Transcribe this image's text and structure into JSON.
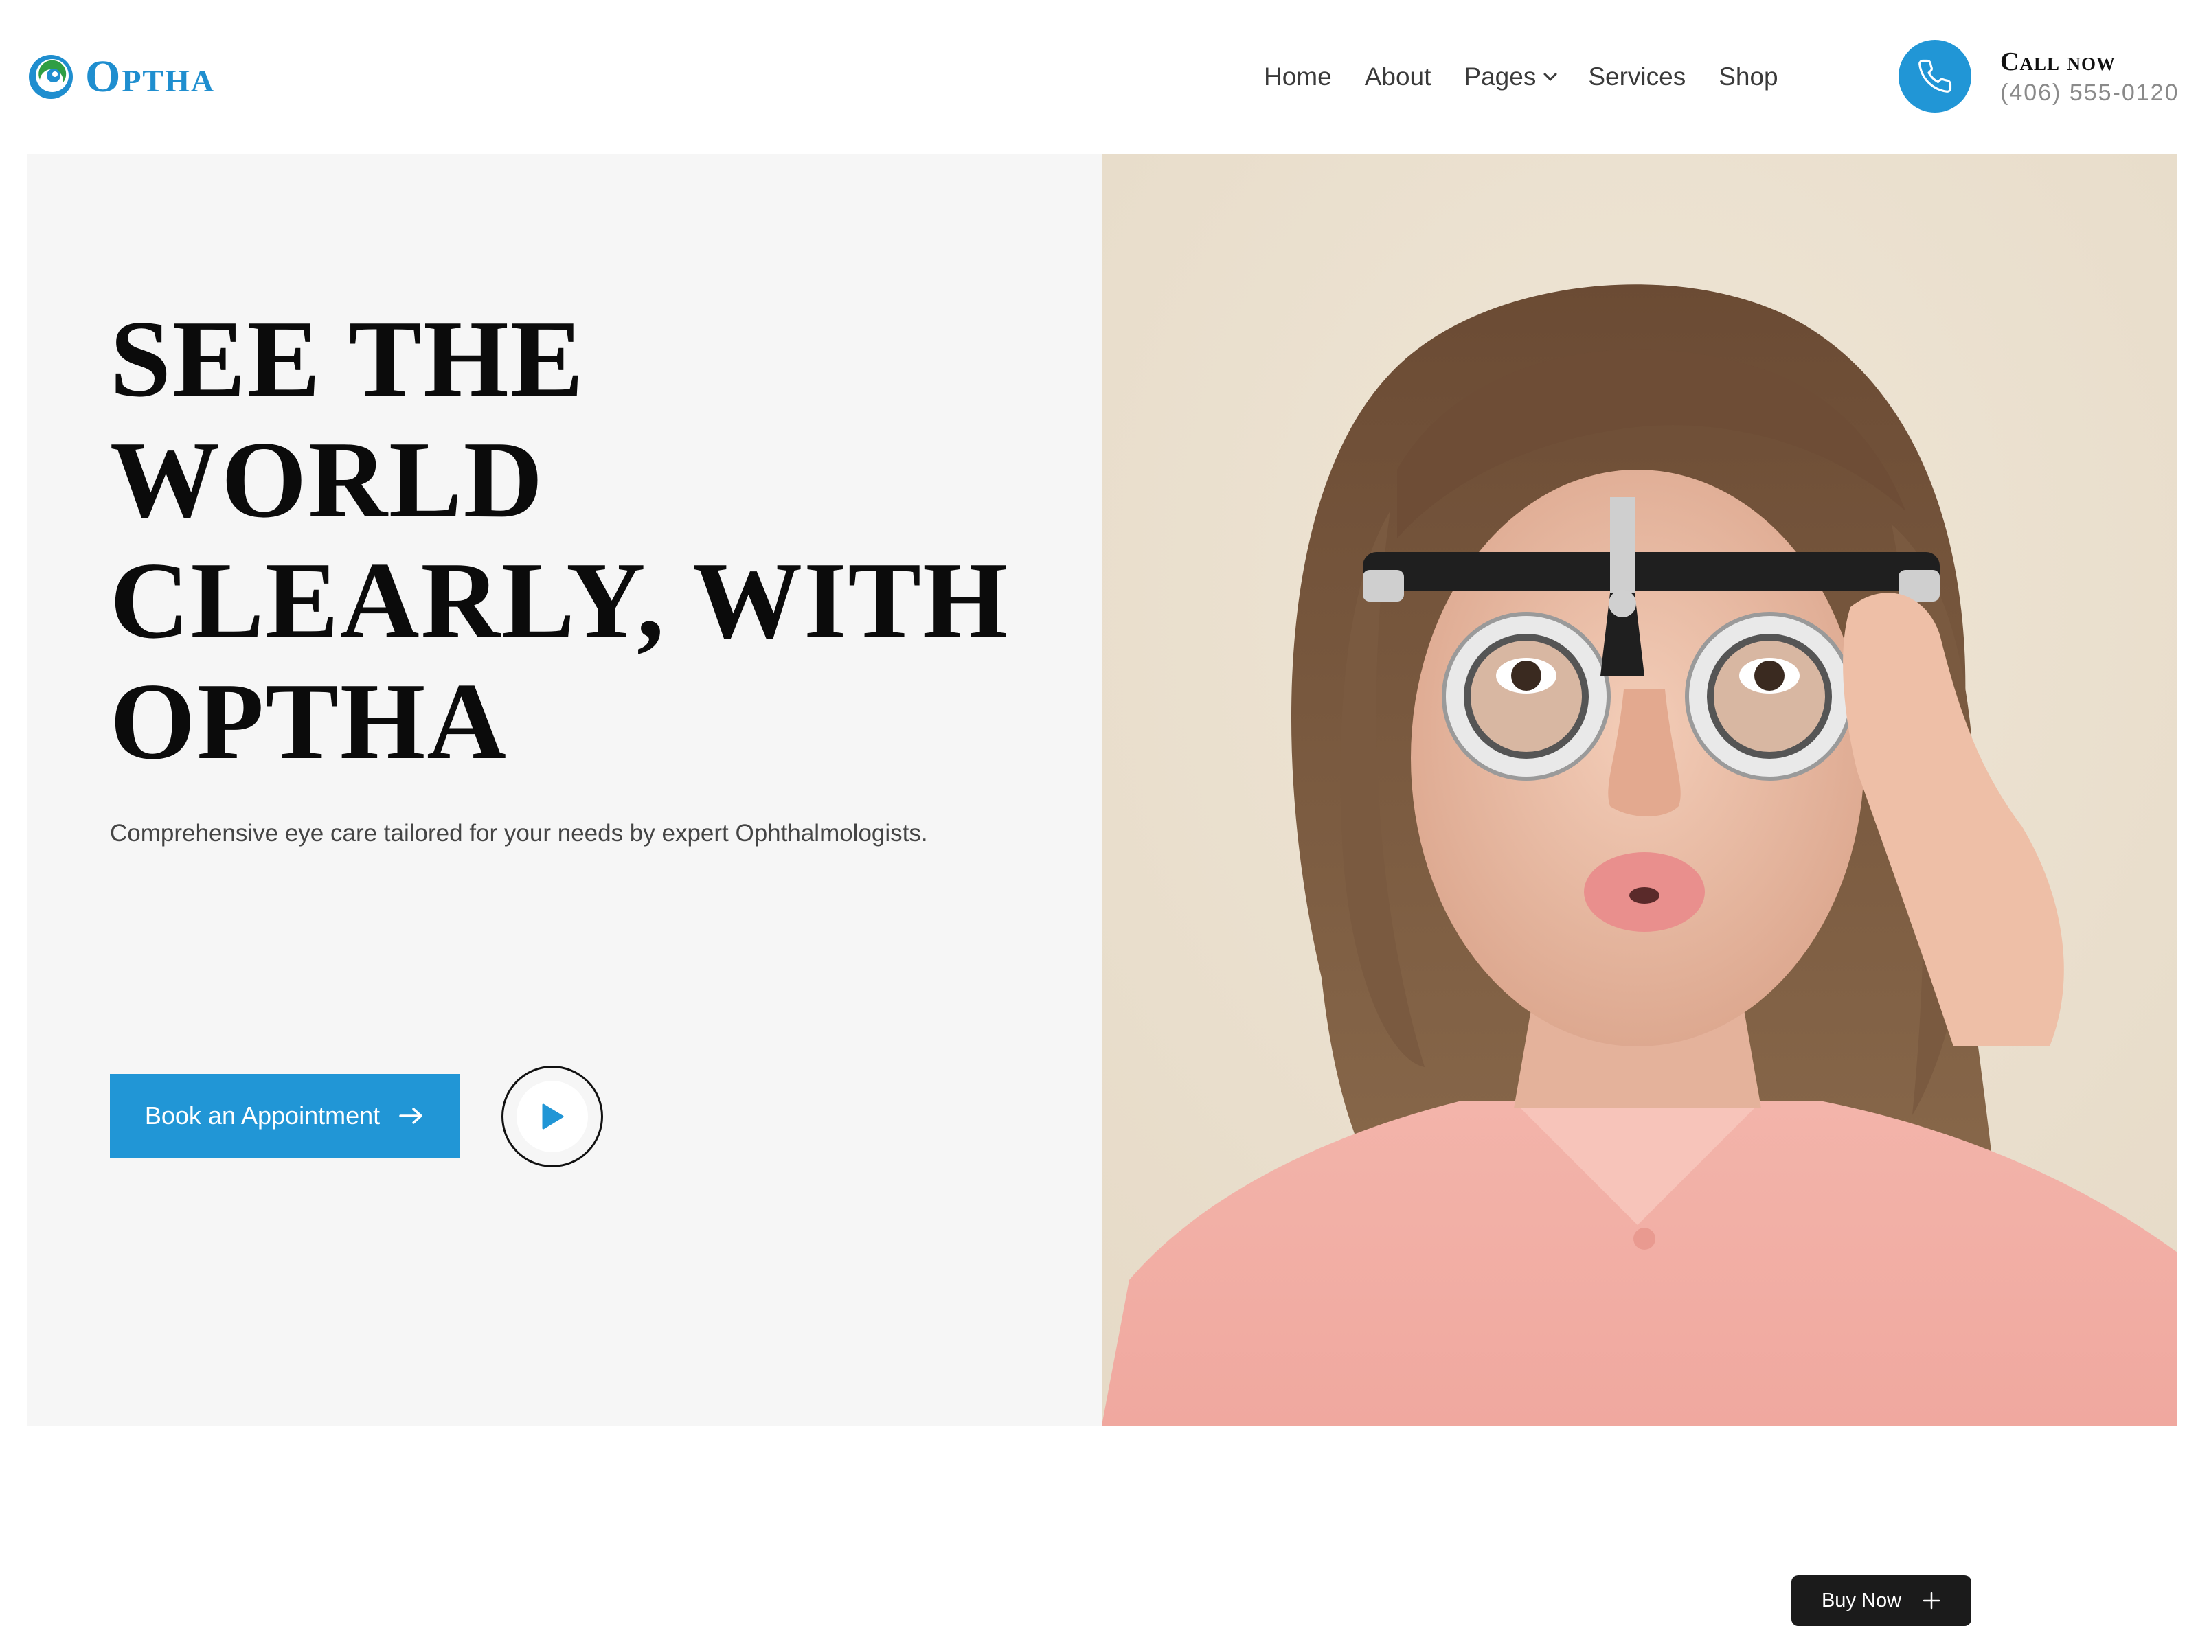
{
  "brand": {
    "name": "Optha",
    "color": "#1f8ecf",
    "accent_green": "#2f9e44"
  },
  "nav": {
    "items": [
      {
        "label": "Home",
        "has_dropdown": false
      },
      {
        "label": "About",
        "has_dropdown": false
      },
      {
        "label": "Pages",
        "has_dropdown": true
      },
      {
        "label": "Services",
        "has_dropdown": false
      },
      {
        "label": "Shop",
        "has_dropdown": false
      }
    ]
  },
  "call": {
    "title": "Call now",
    "phone": "(406) 555-0120",
    "icon": "phone-icon"
  },
  "hero": {
    "title": "SEE THE WORLD CLEARLY, WITH OPTHA",
    "subtitle": "Comprehensive eye care tailored for your needs by expert Ophthalmologists.",
    "cta_label": "Book an Appointment",
    "cta_icon": "arrow-right-icon",
    "play_icon": "play-icon",
    "image_description_icon": "hero-photo"
  },
  "buy_now": {
    "label": "Buy Now",
    "icon": "plus-icon"
  },
  "colors": {
    "primary": "#2196d6",
    "hero_bg": "#f6f6f6",
    "dark": "#1b1b1b"
  }
}
